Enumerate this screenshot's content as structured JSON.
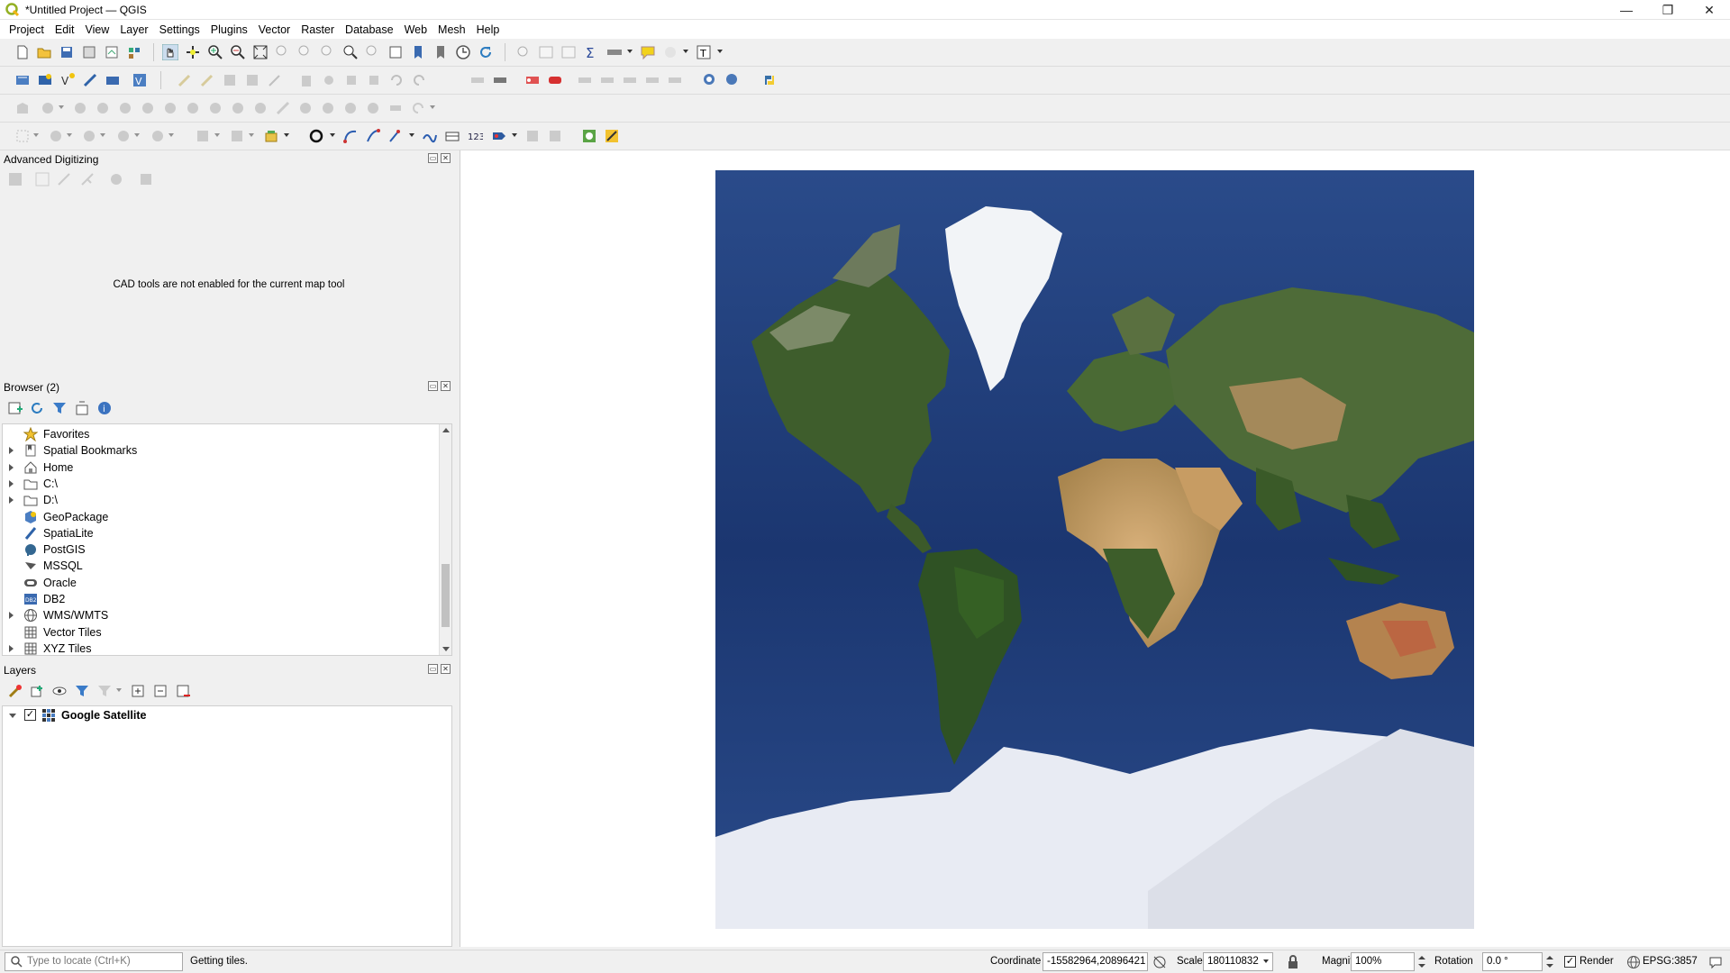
{
  "window": {
    "title": "*Untitled Project — QGIS",
    "controls": {
      "minimize": "—",
      "maximize": "❐",
      "close": "✕"
    }
  },
  "menubar": {
    "items": [
      "Project",
      "Edit",
      "View",
      "Layer",
      "Settings",
      "Plugins",
      "Vector",
      "Raster",
      "Database",
      "Web",
      "Mesh",
      "Help"
    ]
  },
  "advanced_digitizing": {
    "title": "Advanced Digitizing",
    "message": "CAD tools are not enabled for the current map tool"
  },
  "browser": {
    "title": "Browser (2)",
    "items": [
      {
        "label": "Favorites",
        "icon": "star-icon",
        "expandable": false
      },
      {
        "label": "Spatial Bookmarks",
        "icon": "bookmark-icon",
        "expandable": true
      },
      {
        "label": "Home",
        "icon": "home-icon",
        "expandable": true
      },
      {
        "label": "C:\\",
        "icon": "folder-icon",
        "expandable": true
      },
      {
        "label": "D:\\",
        "icon": "folder-icon",
        "expandable": true
      },
      {
        "label": "GeoPackage",
        "icon": "geopackage-icon",
        "expandable": false
      },
      {
        "label": "SpatiaLite",
        "icon": "spatialite-icon",
        "expandable": false
      },
      {
        "label": "PostGIS",
        "icon": "postgis-icon",
        "expandable": false
      },
      {
        "label": "MSSQL",
        "icon": "mssql-icon",
        "expandable": false
      },
      {
        "label": "Oracle",
        "icon": "oracle-icon",
        "expandable": false
      },
      {
        "label": "DB2",
        "icon": "db2-icon",
        "expandable": false
      },
      {
        "label": "WMS/WMTS",
        "icon": "wms-icon",
        "expandable": true
      },
      {
        "label": "Vector Tiles",
        "icon": "vector-tiles-icon",
        "expandable": false
      },
      {
        "label": "XYZ Tiles",
        "icon": "xyz-tiles-icon",
        "expandable": true
      }
    ]
  },
  "layers": {
    "title": "Layers",
    "items": [
      {
        "label": "Google Satellite",
        "checked": true,
        "icon": "raster-layer-icon"
      }
    ]
  },
  "statusbar": {
    "locator_placeholder": "Type to locate (Ctrl+K)",
    "message": "Getting tiles.",
    "coordinate_label": "Coordinate",
    "coordinate_value": "-15582964,20896421",
    "scale_label": "Scale",
    "scale_value": "180110832",
    "magnifier_label": "Magnifier",
    "magnifier_value": "100%",
    "rotation_label": "Rotation",
    "rotation_value": "0.0 °",
    "render_label": "Render",
    "render_checked": true,
    "crs": "EPSG:3857"
  },
  "colors": {
    "ocean": "#1f3a73",
    "land_green": "#3d5a2a",
    "desert": "#c9a268",
    "ice": "#e8ebf3"
  }
}
